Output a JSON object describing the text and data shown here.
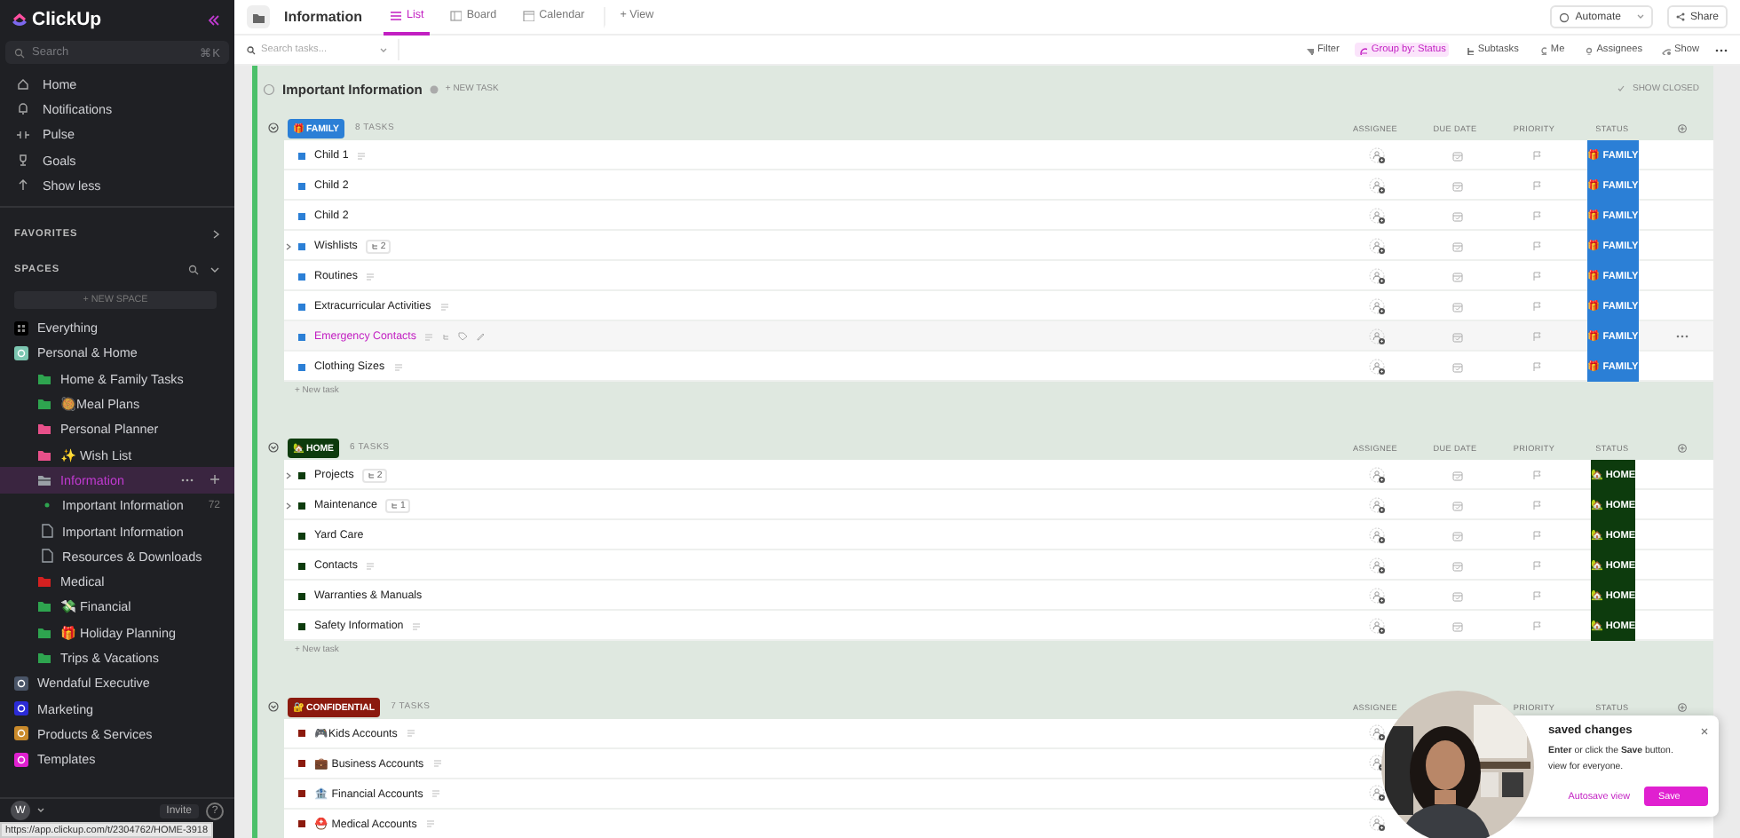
{
  "sidebar": {
    "logo": "ClickUp",
    "search": {
      "placeholder": "Search",
      "shortcut": "⌘K"
    },
    "nav": [
      {
        "label": "Home"
      },
      {
        "label": "Notifications"
      },
      {
        "label": "Pulse"
      },
      {
        "label": "Goals"
      },
      {
        "label": "Show less"
      }
    ],
    "favorites": "FAVORITES",
    "spaces_title": "SPACES",
    "new_space": "+ NEW SPACE",
    "spaces": [
      {
        "label": "Everything",
        "kind": "everything",
        "selected": false
      },
      {
        "label": "Personal & Home",
        "kind": "space",
        "color": "#7cc6b1",
        "selected": false,
        "children": [
          {
            "label": "Home & Family Tasks",
            "kind": "folder",
            "color": "#2ea44f",
            "selected": false
          },
          {
            "label": "🥘Meal Plans",
            "kind": "folder",
            "color": "#2ea44f",
            "selected": false
          },
          {
            "label": "Personal Planner",
            "kind": "folder",
            "color": "#e8508a",
            "selected": false
          },
          {
            "label": "✨ Wish List",
            "kind": "folder",
            "color": "#e8508a",
            "selected": false
          },
          {
            "label": "Information",
            "kind": "folder",
            "color": "#9aa0a6",
            "selected": true,
            "expanded": true,
            "children": [
              {
                "label": "Important Information",
                "kind": "list",
                "color": "#2ea44f",
                "count": "72",
                "selected": false
              },
              {
                "label": "Important Information",
                "kind": "doc",
                "selected": false
              },
              {
                "label": "Resources & Downloads",
                "kind": "doc",
                "selected": false
              }
            ]
          },
          {
            "label": "Medical",
            "kind": "folder",
            "color": "#d42020",
            "selected": false
          },
          {
            "label": "💸 Financial",
            "kind": "folder",
            "color": "#2ea44f",
            "selected": false
          },
          {
            "label": "🎁 Holiday Planning",
            "kind": "folder",
            "color": "#2ea44f",
            "selected": false
          },
          {
            "label": "Trips & Vacations",
            "kind": "folder",
            "color": "#2ea44f",
            "selected": false
          }
        ]
      },
      {
        "label": "Wendaful Executive",
        "kind": "space",
        "color": "#4a5568",
        "selected": false
      },
      {
        "label": "Marketing",
        "kind": "space",
        "color": "#2b2bd6",
        "selected": false
      },
      {
        "label": "Products & Services",
        "kind": "space",
        "color": "#c98a2b",
        "selected": false
      },
      {
        "label": "Templates",
        "kind": "space",
        "color": "#e020d0",
        "selected": false
      }
    ],
    "user": {
      "initial": "W",
      "invite": "Invite",
      "help": "?"
    }
  },
  "link_preview": "https://app.clickup.com/t/2304762/HOME-3918",
  "header": {
    "title": "Information",
    "views": [
      {
        "label": "List",
        "selected": true
      },
      {
        "label": "Board",
        "selected": false
      },
      {
        "label": "Calendar",
        "selected": false
      }
    ],
    "add_view": "+ View",
    "automate": "Automate",
    "share": "Share"
  },
  "toolbar": {
    "search_placeholder": "Search tasks...",
    "filters": [
      {
        "label": "Filter",
        "active": false
      },
      {
        "label": "Group by: Status",
        "active": true
      },
      {
        "label": "Subtasks",
        "active": false
      },
      {
        "label": "Me",
        "active": false
      },
      {
        "label": "Assignees",
        "active": false
      },
      {
        "label": "Show",
        "active": false
      }
    ]
  },
  "list": {
    "title": "Important Information",
    "new_task": "+ NEW TASK",
    "show_closed": "SHOW CLOSED",
    "groups": [
      {
        "status": "🎁 FAMILY",
        "color": "#2b7fd6",
        "count": "8 TASKS",
        "expanded": true,
        "columns": [
          {
            "kind": "assignee",
            "label": "ASSIGNEE"
          },
          {
            "kind": "due_date",
            "label": "DUE DATE"
          },
          {
            "kind": "priority",
            "label": "PRIORITY"
          },
          {
            "kind": "status",
            "label": "STATUS"
          }
        ],
        "tasks": [
          {
            "name": "Child 1",
            "status": "🎁 FAMILY",
            "description": true,
            "hovered": false
          },
          {
            "name": "Child 2",
            "status": "🎁 FAMILY",
            "description": false,
            "hovered": false
          },
          {
            "name": "Child 2",
            "status": "🎁 FAMILY",
            "description": false,
            "hovered": false
          },
          {
            "name": "Wishlists",
            "subtasks": "2",
            "status": "🎁 FAMILY",
            "description": false,
            "hovered": false
          },
          {
            "name": "Routines",
            "status": "🎁 FAMILY",
            "description": true,
            "hovered": false
          },
          {
            "name": "Extracurricular Activities",
            "status": "🎁 FAMILY",
            "description": true,
            "hovered": false
          },
          {
            "name": "Emergency Contacts",
            "status": "🎁 FAMILY",
            "description": true,
            "hovered": true
          },
          {
            "name": "Clothing Sizes",
            "status": "🎁 FAMILY",
            "description": true,
            "hovered": false
          }
        ],
        "new_task": "+ New task"
      },
      {
        "status": "🏡 HOME",
        "color": "#0d3b0d",
        "count": "6 TASKS",
        "expanded": true,
        "columns": [
          {
            "kind": "assignee",
            "label": "ASSIGNEE"
          },
          {
            "kind": "due_date",
            "label": "DUE DATE"
          },
          {
            "kind": "priority",
            "label": "PRIORITY"
          },
          {
            "kind": "status",
            "label": "STATUS"
          }
        ],
        "tasks": [
          {
            "name": "Projects",
            "subtasks": "2",
            "status": "🏡 HOME",
            "description": false,
            "hovered": false
          },
          {
            "name": "Maintenance",
            "subtasks": "1",
            "status": "🏡 HOME",
            "description": false,
            "hovered": false
          },
          {
            "name": "Yard Care",
            "status": "🏡 HOME",
            "description": false,
            "hovered": false
          },
          {
            "name": "Contacts",
            "status": "🏡 HOME",
            "description": true,
            "hovered": false
          },
          {
            "name": "Warranties & Manuals",
            "status": "🏡 HOME",
            "description": false,
            "hovered": false
          },
          {
            "name": "Safety Information",
            "status": "🏡 HOME",
            "description": true,
            "hovered": false
          }
        ],
        "new_task": "+ New task"
      },
      {
        "status": "🔐 CONFIDENTIAL",
        "color": "#8b1a0e",
        "count": "7 TASKS",
        "expanded": true,
        "columns": [
          {
            "kind": "assignee",
            "label": "ASSIGNEE"
          },
          {
            "kind": "priority",
            "label": "PRIORITY"
          },
          {
            "kind": "status",
            "label": "STATUS"
          }
        ],
        "tasks": [
          {
            "name": "🎮Kids Accounts",
            "description": true,
            "hovered": false
          },
          {
            "name": "💼 Business Accounts",
            "description": true,
            "hovered": false
          },
          {
            "name": "🏦 Financial Accounts",
            "description": true,
            "hovered": false
          },
          {
            "name": "⛑️ Medical Accounts",
            "description": true,
            "hovered": false
          }
        ]
      }
    ]
  },
  "save_popup": {
    "title": "saved changes",
    "message": "**Enter** or click the **Save** button.",
    "message_2": "view for everyone.",
    "autosave": "Autosave view",
    "save": "Save"
  }
}
